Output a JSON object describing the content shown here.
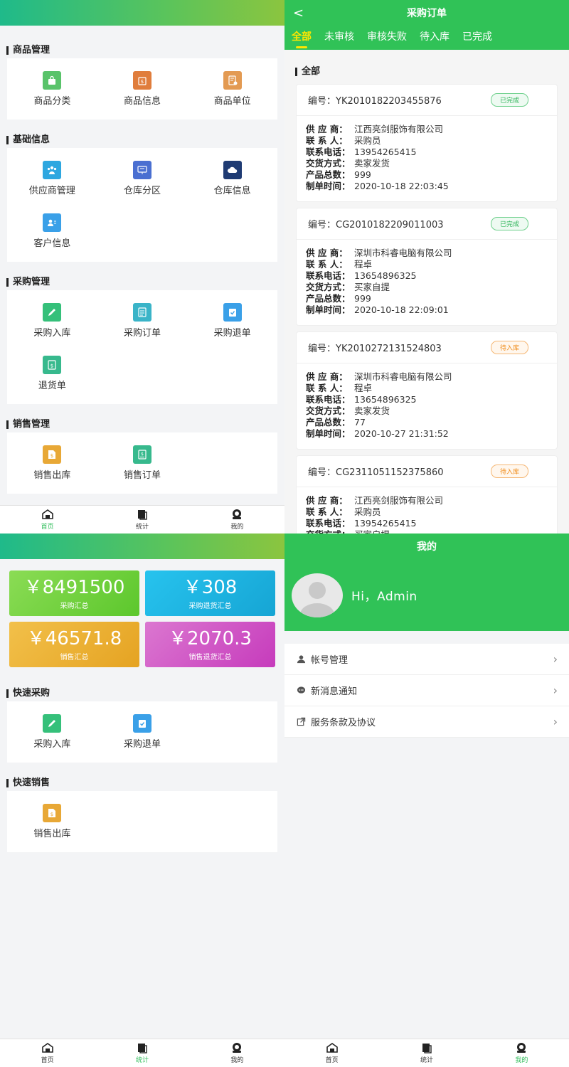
{
  "colors": {
    "accent": "#30c257",
    "active_tab": "#ffe600"
  },
  "home": {
    "sections": [
      {
        "title": "商品管理",
        "items": [
          {
            "label": "商品分类",
            "icon": "bag-icon",
            "color": "#59c36a"
          },
          {
            "label": "商品信息",
            "icon": "dollar-bag-icon",
            "color": "#e07d3c"
          },
          {
            "label": "商品单位",
            "icon": "unit-doc-icon",
            "color": "#e39a52"
          }
        ]
      },
      {
        "title": "基础信息",
        "items": [
          {
            "label": "供应商管理",
            "icon": "users-icon",
            "color": "#2ea7e0"
          },
          {
            "label": "仓库分区",
            "icon": "board-icon",
            "color": "#4a6fd1"
          },
          {
            "label": "仓库信息",
            "icon": "cloud-icon",
            "color": "#1f3b73"
          },
          {
            "label": "客户信息",
            "icon": "user-card-icon",
            "color": "#3aa0e8"
          }
        ]
      },
      {
        "title": "采购管理",
        "items": [
          {
            "label": "采购入库",
            "icon": "pencil-icon",
            "color": "#35c07a"
          },
          {
            "label": "采购订单",
            "icon": "list-doc-icon",
            "color": "#3ab4c8"
          },
          {
            "label": "采购退单",
            "icon": "clipboard-check-icon",
            "color": "#3aa0e8"
          },
          {
            "label": "退货单",
            "icon": "dollar-doc-icon",
            "color": "#37b98d"
          }
        ]
      },
      {
        "title": "销售管理",
        "items": [
          {
            "label": "销售出库",
            "icon": "dollar-file-icon",
            "color": "#e8a836"
          },
          {
            "label": "销售订单",
            "icon": "dollar-note-icon",
            "color": "#37b98d"
          }
        ]
      }
    ]
  },
  "tabbar": [
    {
      "label": "首页",
      "icon": "home-icon"
    },
    {
      "label": "统计",
      "icon": "stats-icon"
    },
    {
      "label": "我的",
      "icon": "profile-icon"
    }
  ],
  "orders": {
    "back": "<",
    "title": "采购订单",
    "tabs": [
      "全部",
      "未审核",
      "审核失败",
      "待入库",
      "已完成"
    ],
    "section_title": "全部",
    "labels": {
      "code": "编号：",
      "supplier": "供 应 商：",
      "contact": "联 系 人：",
      "phone": "联系电话：",
      "delivery": "交货方式：",
      "count": "产品总数：",
      "created": "制单时间："
    },
    "list": [
      {
        "code": "YK2010182203455876",
        "status": "已完成",
        "status_type": "done",
        "supplier": "江西亮剑服饰有限公司",
        "contact": "采购员",
        "phone": "13954265415",
        "delivery": "卖家发货",
        "count": "999",
        "created": "2020-10-18 22:03:45"
      },
      {
        "code": "CG2010182209011003",
        "status": "已完成",
        "status_type": "done",
        "supplier": "深圳市科睿电脑有限公司",
        "contact": "程卓",
        "phone": "13654896325",
        "delivery": "买家自提",
        "count": "999",
        "created": "2020-10-18 22:09:01"
      },
      {
        "code": "YK2010272131524803",
        "status": "待入库",
        "status_type": "pend",
        "supplier": "深圳市科睿电脑有限公司",
        "contact": "程卓",
        "phone": "13654896325",
        "delivery": "卖家发货",
        "count": "77",
        "created": "2020-10-27 21:31:52"
      },
      {
        "code": "CG2311051152375860",
        "status": "待入库",
        "status_type": "pend",
        "supplier": "江西亮剑服饰有限公司",
        "contact": "采购员",
        "phone": "13954265415",
        "delivery": "买家自提",
        "count": "",
        "created": ""
      }
    ]
  },
  "stats": {
    "cards": [
      {
        "value": "￥8491500",
        "caption": "采购汇总",
        "gradient": [
          "#8bdc55",
          "#5cc72c"
        ]
      },
      {
        "value": "￥308",
        "caption": "采购退货汇总",
        "gradient": [
          "#27c3ee",
          "#16a5d4"
        ]
      },
      {
        "value": "￥46571.8",
        "caption": "销售汇总",
        "gradient": [
          "#f2c04a",
          "#e5a322"
        ]
      },
      {
        "value": "￥2070.3",
        "caption": "销售退货汇总",
        "gradient": [
          "#db77d0",
          "#c63bbc"
        ]
      }
    ],
    "sections": [
      {
        "title": "快速采购",
        "items": [
          {
            "label": "采购入库",
            "icon": "pencil-icon",
            "color": "#35c07a"
          },
          {
            "label": "采购退单",
            "icon": "clipboard-check-icon",
            "color": "#3aa0e8"
          }
        ]
      },
      {
        "title": "快速销售",
        "items": [
          {
            "label": "销售出库",
            "icon": "dollar-file-icon",
            "color": "#e8a836"
          }
        ]
      }
    ]
  },
  "profile": {
    "title": "我的",
    "greeting": "Hi，Admin",
    "menu": [
      {
        "label": "帐号管理",
        "icon": "user-icon"
      },
      {
        "label": "新消息通知",
        "icon": "chat-icon"
      },
      {
        "label": "服务条款及协议",
        "icon": "external-link-icon"
      }
    ]
  }
}
